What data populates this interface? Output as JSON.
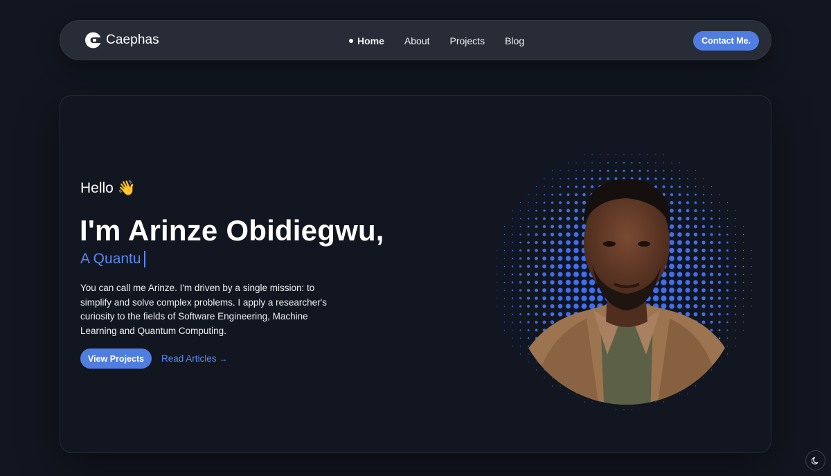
{
  "brand": {
    "name": "Caephas",
    "logo_icon": "caephas-logo-icon"
  },
  "nav": {
    "items": [
      {
        "label": "Home",
        "active": true
      },
      {
        "label": "About",
        "active": false
      },
      {
        "label": "Projects",
        "active": false
      },
      {
        "label": "Blog",
        "active": false
      }
    ],
    "contact_label": "Contact Me."
  },
  "hero": {
    "greeting": "Hello 👋",
    "name_line": "I'm Arinze Obidiegwu,",
    "role_typed": "A Quantu",
    "bio": "You can call me Arinze. I'm driven by a single mission: to simplify and solve complex problems. I apply a researcher's curiosity to the fields of Software Engineering, Machine Learning and Quantum Computing.",
    "primary_cta": "View Projects",
    "secondary_cta": "Read Articles",
    "secondary_cta_icon": "→"
  },
  "portrait": {
    "icon": "halftone-dots-portrait",
    "dot_color": "#3f6ff0"
  },
  "theme_toggle": {
    "icon": "moon-icon"
  },
  "colors": {
    "background": "#121620",
    "navbar": "#272c36",
    "accent": "#4f7de0",
    "accent_text": "#5a88ee"
  }
}
